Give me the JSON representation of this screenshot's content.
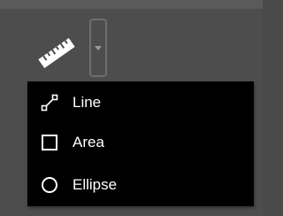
{
  "toolbar": {
    "ruler_icon": "ruler-icon",
    "dropdown_icon": "chevron-down-icon"
  },
  "menu": {
    "items": [
      {
        "label": "Line",
        "icon": "line-measure-icon"
      },
      {
        "label": "Area",
        "icon": "square-icon"
      },
      {
        "label": "Ellipse",
        "icon": "circle-icon"
      }
    ]
  },
  "colors": {
    "background": "#4d4d4d",
    "menu_background": "#000000",
    "text": "#ffffff",
    "toggle_border": "#6f6f6f",
    "chevron": "#9a9a9a"
  }
}
